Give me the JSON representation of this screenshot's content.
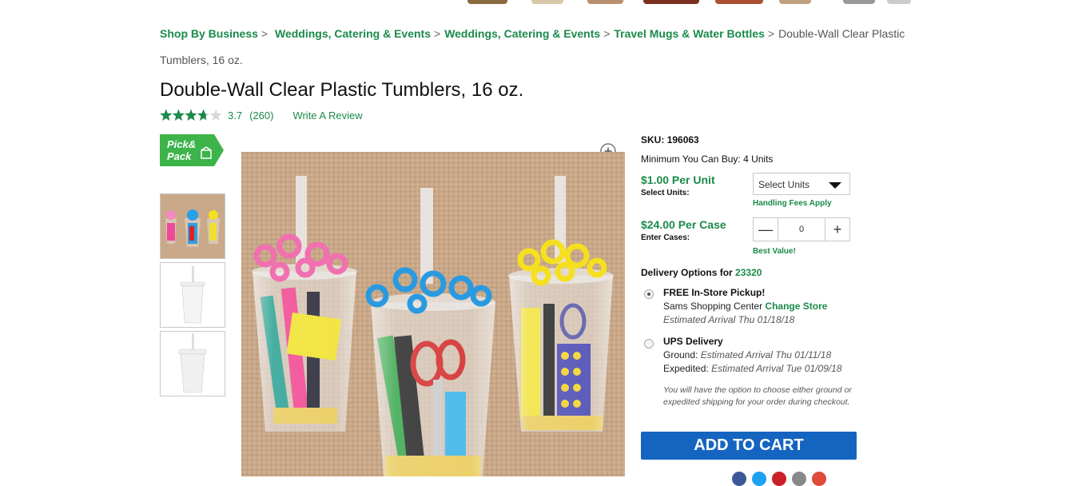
{
  "breadcrumb": {
    "items": [
      "Shop By Business",
      "Weddings, Catering & Events",
      "Weddings, Catering & Events",
      "Travel Mugs & Water Bottles"
    ],
    "separator": ">",
    "current": "Double-Wall Clear Plastic Tumblers, 16 oz."
  },
  "product": {
    "title": "Double-Wall Clear Plastic Tumblers, 16 oz.",
    "rating": 3.7,
    "rating_max": 5,
    "rating_value": "3.7",
    "review_count": "(260)",
    "write_review": "Write A Review",
    "badge_text": [
      "Pick&",
      "Pack"
    ]
  },
  "purchase": {
    "sku_label": "SKU:",
    "sku": "196063",
    "minimum": "Minimum You Can Buy: 4 Units",
    "unit_price": "$1.00 Per Unit",
    "unit_label": "Select Units:",
    "select_placeholder": "Select Units",
    "handling": "Handling Fees Apply",
    "case_price": "$24.00 Per Case",
    "case_label": "Enter Cases:",
    "case_qty": "0",
    "best_value": "Best Value!",
    "add_to_cart": "ADD TO CART"
  },
  "delivery": {
    "heading": "Delivery Options for",
    "zip": "23320",
    "pickup": {
      "title": "FREE In-Store Pickup!",
      "store": "Sams Shopping Center",
      "change": "Change Store",
      "arrival": "Estimated Arrival Thu 01/18/18",
      "selected": true
    },
    "ups": {
      "title": "UPS Delivery",
      "ground_label": "Ground:",
      "ground": "Estimated Arrival Thu 01/11/18",
      "expedited_label": "Expedited:",
      "expedited": "Estimated Arrival Tue 01/09/18",
      "selected": false
    },
    "note": "You will have the option to choose either ground or expedited shipping for your order during checkout."
  },
  "colors": {
    "brand_green": "#1a8a4a",
    "cart_blue": "#1565c0",
    "star": "#1a8a4a",
    "badge_green": "#3cb44a"
  },
  "icons": [
    "zoom-icon",
    "minus-icon",
    "plus-icon",
    "dropdown-arrow-icon",
    "star-icon",
    "facebook-icon",
    "twitter-icon",
    "pinterest-icon",
    "email-icon",
    "google-plus-icon"
  ]
}
